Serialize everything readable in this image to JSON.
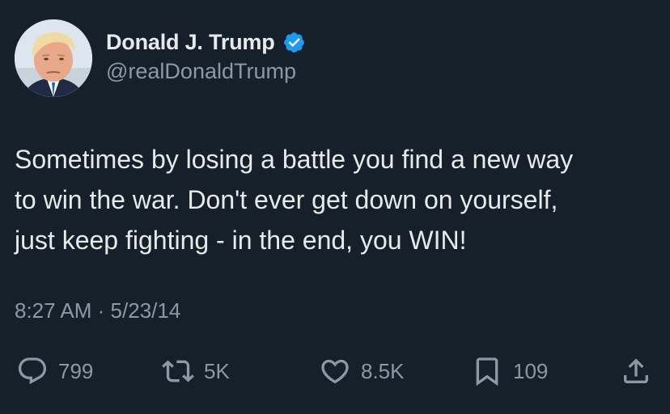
{
  "author": {
    "display_name": "Donald J. Trump",
    "handle": "@realDonaldTrump",
    "verified": true,
    "verified_color": "#1d9bf0"
  },
  "tweet": {
    "text": "Sometimes by losing a battle you find a new way\nto win the war. Don't ever get down on yourself,\njust keep fighting - in the end, you WIN!",
    "time": "8:27 AM",
    "separator": "·",
    "date": "5/23/14"
  },
  "stats": {
    "replies": "799",
    "retweets": "5K",
    "likes": "8.5K",
    "bookmarks": "109"
  },
  "icons": {
    "reply": "speech-bubble-icon",
    "retweet": "retweet-arrows-icon",
    "like": "heart-icon",
    "bookmark": "bookmark-icon",
    "share": "share-upload-icon"
  },
  "colors": {
    "background": "#15202b",
    "primary_text": "#e7e9ea",
    "secondary_text": "#8b98a5"
  }
}
